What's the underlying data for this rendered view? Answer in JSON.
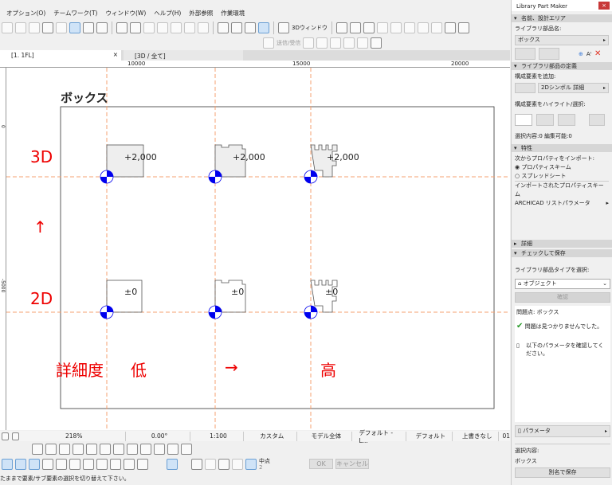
{
  "menu": [
    "オプション(O)",
    "チームワーク(T)",
    "ウィンドウ(W)",
    "ヘルプ(H)",
    "外部参照",
    "作業環境"
  ],
  "toolbar": {
    "window3d_label": "3Dウィンドウ",
    "send_receive_label": "送信/受信"
  },
  "tabs": [
    {
      "label": "[1. 1FL]",
      "close": "×"
    },
    {
      "label": "[3D / 全て]"
    }
  ],
  "ruler": {
    "h": [
      "10000",
      "15000",
      "20000"
    ],
    "v": [
      "0",
      "-5000"
    ]
  },
  "canvas": {
    "title": "ボックス",
    "row_3d": "3D",
    "arrow_up": "↑",
    "row_2d": "2D",
    "detail_label": "詳細度",
    "low": "低",
    "arrow_right": "→",
    "high": "高",
    "elev_3d": "+2,000",
    "elev_2d": "±0",
    "guide_color": "#f4a070",
    "hotspot_color": "#0000ee",
    "label_color": "#e00000"
  },
  "bottom": {
    "zoom": "218%",
    "angle": "0.00°",
    "scale": "1:100",
    "layer": "カスタム",
    "model": "モデル全体",
    "pen": "デフォルト - L...",
    "view": "デフォルト",
    "override": "上書きなし",
    "story": "01",
    "snap_label": "中点",
    "snap_value": "2",
    "ok": "OK",
    "cancel": "キャンセル",
    "status": "たままで要素/サブ要素の選択を切り替えて下さい。"
  },
  "panel": {
    "title": "Library Part Maker",
    "close": "×",
    "sec1": "名前、設計エリア",
    "name_label": "ライブラリ部品名:",
    "name_value": "ボックス",
    "sec2": "ライブラリ部品の定義",
    "add_label": "構成要素を追加:",
    "add_value": "2Dシンボル 詳細",
    "highlight_label": "構成要素をハイライト/選択:",
    "selection_info": "選択内容:0 編集可能:0",
    "sec3": "特性",
    "import_label": "次からプロパティをインポート:",
    "radio1": "プロパティスキーム",
    "radio2": "スプレッドシート",
    "imported_label": "インポートされたプロパティスキーム",
    "imported_value": "ARCHICAD リストパラメータ",
    "sec4": "詳細",
    "sec5": "チェックして保存",
    "type_label": "ライブラリ部品タイプを選択:",
    "type_value": "オブジェクト",
    "confirm": "確認",
    "issues_title": "問題点: ボックス",
    "ok_msg": "問題は見つかりませんでした。",
    "param_msg": "以下のパラメータを確認してください。",
    "param_button": "パラメータ",
    "selected_label": "選択内容:",
    "selected_value": "ボックス",
    "save_as": "別名で保存"
  }
}
